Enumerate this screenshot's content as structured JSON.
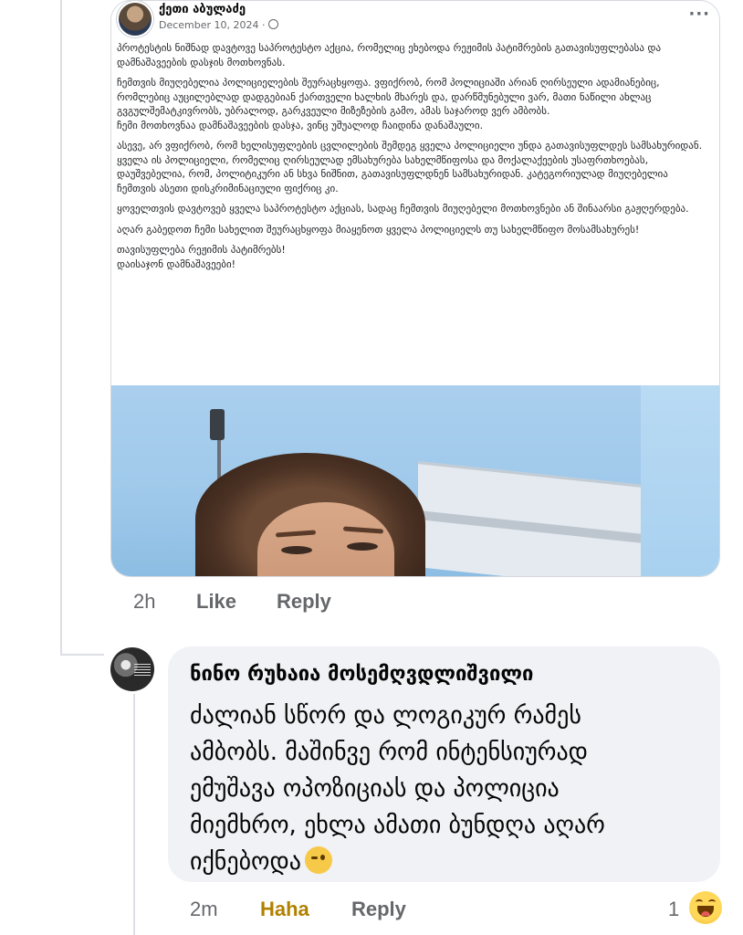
{
  "shared_post": {
    "author_name": "ქეთი აბულაძე",
    "date": "December 10, 2024 ·",
    "more_icon": "more-horizontal-icon",
    "paragraphs": [
      "პროტესტის ნიშნად დავტოვე საპროტესტო აქცია, რომელიც ეხებოდა რეჟიმის პატიმრების გათავისუფლებასა და დამნაშავეების დასჯის მოთხოვნას.",
      "ჩემთვის მიუღებელია პოლიციელების შეურაცხყოფა. ვფიქრობ, რომ პოლიციაში არიან ღირსეული ადამიანებიც, რომლებიც აუცილებლად დადგებიან ქართველი ხალხის მხარეს და, დარწმუნებული ვარ, მათი ნაწილი ახლაც გვგულშემატკივრობს, უბრალოდ, გარკვეული მიზეზების გამო, ამას საჯაროდ ვერ ამბობს.\nჩემი მოთხოვნაა დამნაშავეების დასჯა, ვინც უშუალოდ ჩაიდინა დანაშაული.",
      "ასევე, არ ვფიქრობ, რომ ხელისუფლების ცვლილების შემდეგ ყველა პოლიციელი უნდა გათავისუფლდეს სამსახურიდან. ყველა ის პოლიციელი, რომელიც ღირსეულად ემსახურება სახელმწიფოსა და მოქალაქეების უსაფრთხოებას, დაუშვებელია, რომ, პოლიტიკური ან სხვა ნიშნით, გათავისუფლდნენ სამსახურიდან. კატეგორიულად მიუღებელია ჩემთვის ასეთი დისკრიმინაციული ფიქრიც კი.",
      "ყოველთვის დავტოვებ ყველა საპროტესტო აქციას, სადაც ჩემთვის მიუღებელი მოთხოვნები ან შინაარსი გაჟღერდება.",
      "აღარ გაბედოთ ჩემი სახელით შეურაცხყოფა მიაყენოთ ყველა პოლიციელს თუ სახელმწიფო მოსამსახურეს!",
      "თავისუფლება რეჟიმის პატიმრებს!\nდაისაჯონ დამნაშავეები!"
    ]
  },
  "reply_actions": {
    "time": "2h",
    "like_label": "Like",
    "reply_label": "Reply"
  },
  "comment": {
    "author_name": "ნინო რუხაია მოსემღვდლიშვილი",
    "text": "ძალიან სწორ და ლოგიკურ რამეს ამბობს. მაშინვე რომ ინტენსიურად ემუშავა ოპოზიციას და პოლიცია მიემხრო, ეხლა ამათი ბუნდღა აღარ იქნებოდა",
    "emoji_icon": "wink-emoji-icon"
  },
  "comment_actions": {
    "time": "2m",
    "reaction_label": "Haha",
    "reply_label": "Reply",
    "reaction_count": "1",
    "reaction_icon": "haha-emoji-icon"
  },
  "colors": {
    "reaction_haha_text": "#b08100",
    "meta_gray": "#65676b",
    "bubble_bg": "#f0f2f5"
  }
}
